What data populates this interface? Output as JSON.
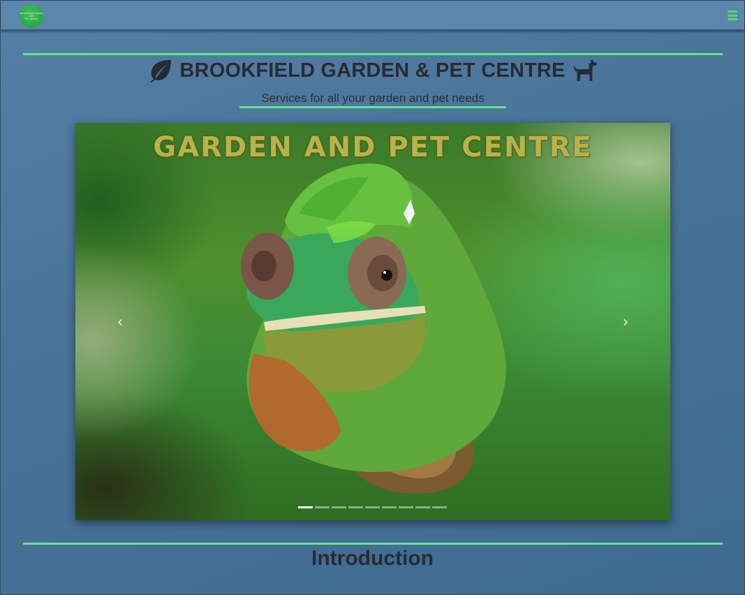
{
  "navbar": {
    "logo_text": [
      "BROOKFIELD GARDEN",
      "AND",
      "PET CENTRE"
    ],
    "menu_icon": "hamburger-icon",
    "accent": "#4ddb72"
  },
  "header": {
    "title": "BROOKFIELD GARDEN & PET CENTRE",
    "left_icon": "leaf-icon",
    "right_icon": "dog-icon",
    "subtitle": "Services for all your garden and pet needs"
  },
  "carousel": {
    "banner_text": "GARDEN AND PET CENTRE",
    "prev_icon": "chevron-left-icon",
    "next_icon": "chevron-right-icon",
    "prev_glyph": "‹",
    "next_glyph": "›",
    "slide_count": 9,
    "active_slide": 1
  },
  "intro": {
    "heading": "Introduction"
  },
  "colors": {
    "rule": "#5fe88a",
    "background": "#4a7399",
    "navbar": "#5a87ab"
  }
}
